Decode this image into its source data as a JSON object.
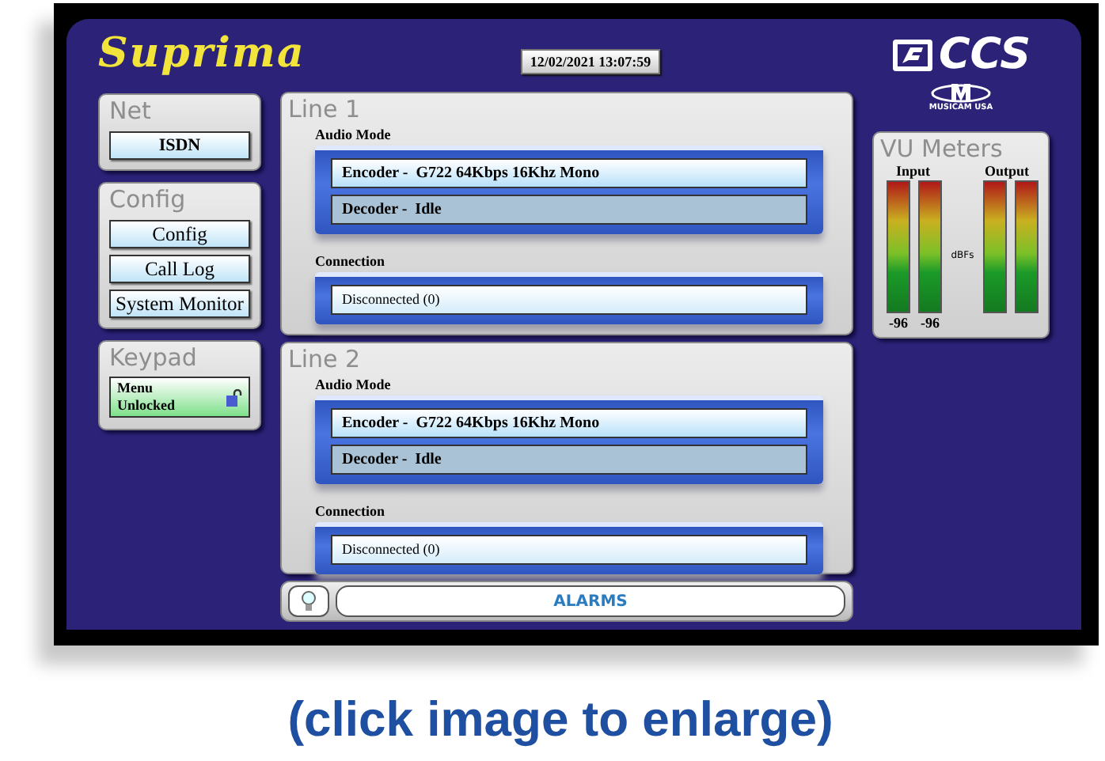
{
  "brand": {
    "name": "Suprima"
  },
  "datetime": "12/02/2021 13:07:59",
  "logo": {
    "text": "CCS",
    "subtext": "MUSICAM USA"
  },
  "sidebar": [
    {
      "title": "Net",
      "buttons": [
        "ISDN"
      ]
    },
    {
      "title": "Config",
      "buttons": [
        "Config",
        "Call Log",
        "System Monitor"
      ]
    }
  ],
  "keypad": {
    "title": "Keypad",
    "label": "Menu",
    "state": "Unlocked",
    "locked": false
  },
  "lines": [
    {
      "title": "Line 1",
      "audio_mode_label": "Audio Mode",
      "modes": [
        {
          "text": "Encoder -  G722 64Kbps 16Khz Mono",
          "active": true
        },
        {
          "text": "Decoder -  Idle",
          "active": false
        }
      ],
      "connection_label": "Connection",
      "connection": "Disconnected (0)"
    },
    {
      "title": "Line 2",
      "audio_mode_label": "Audio Mode",
      "modes": [
        {
          "text": "Encoder -  G722 64Kbps 16Khz Mono",
          "active": true
        },
        {
          "text": "Decoder -  Idle",
          "active": false
        }
      ],
      "connection_label": "Connection",
      "connection": "Disconnected (0)"
    }
  ],
  "vu_meters": {
    "title": "VU Meters",
    "input_label": "Input",
    "output_label": "Output",
    "unit": "dBFs",
    "input_readings": [
      "-96",
      "-96"
    ]
  },
  "alarms": {
    "label": "ALARMS"
  },
  "caption": "(click image to enlarge)"
}
